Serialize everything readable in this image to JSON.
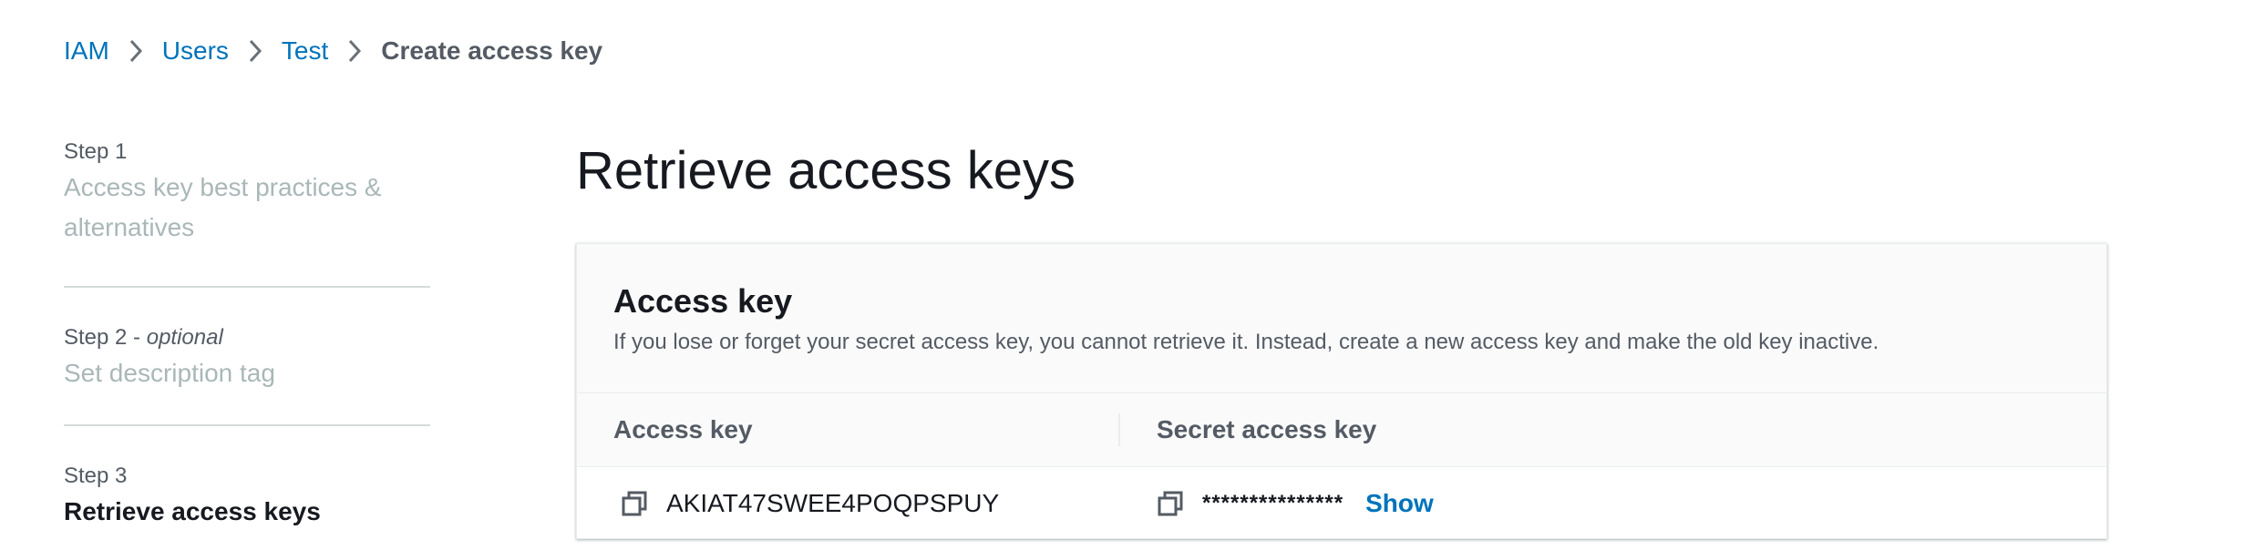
{
  "breadcrumb": {
    "items": [
      {
        "label": "IAM"
      },
      {
        "label": "Users"
      },
      {
        "label": "Test"
      }
    ],
    "current": "Create access key"
  },
  "steps": [
    {
      "number": "Step 1",
      "optional": "",
      "title": "Access key best practices & alternatives",
      "active": false
    },
    {
      "number": "Step 2 - ",
      "optional": "optional",
      "title": "Set description tag",
      "active": false
    },
    {
      "number": "Step 3",
      "optional": "",
      "title": "Retrieve access keys",
      "active": true
    }
  ],
  "page": {
    "title": "Retrieve access keys"
  },
  "access_key_panel": {
    "title": "Access key",
    "description": "If you lose or forget your secret access key, you cannot retrieve it. Instead, create a new access key and make the old key inactive.",
    "columns": [
      "Access key",
      "Secret access key"
    ],
    "row": {
      "access_key_id": "AKIAT47SWEE4POQPSPUY",
      "secret_masked": "***************",
      "show_label": "Show"
    }
  },
  "colors": {
    "link": "#0073bb",
    "text": "#16191f",
    "muted": "#545b64",
    "disabled": "#aab7b8"
  },
  "icons": [
    "chevron-right-icon",
    "copy-icon"
  ]
}
